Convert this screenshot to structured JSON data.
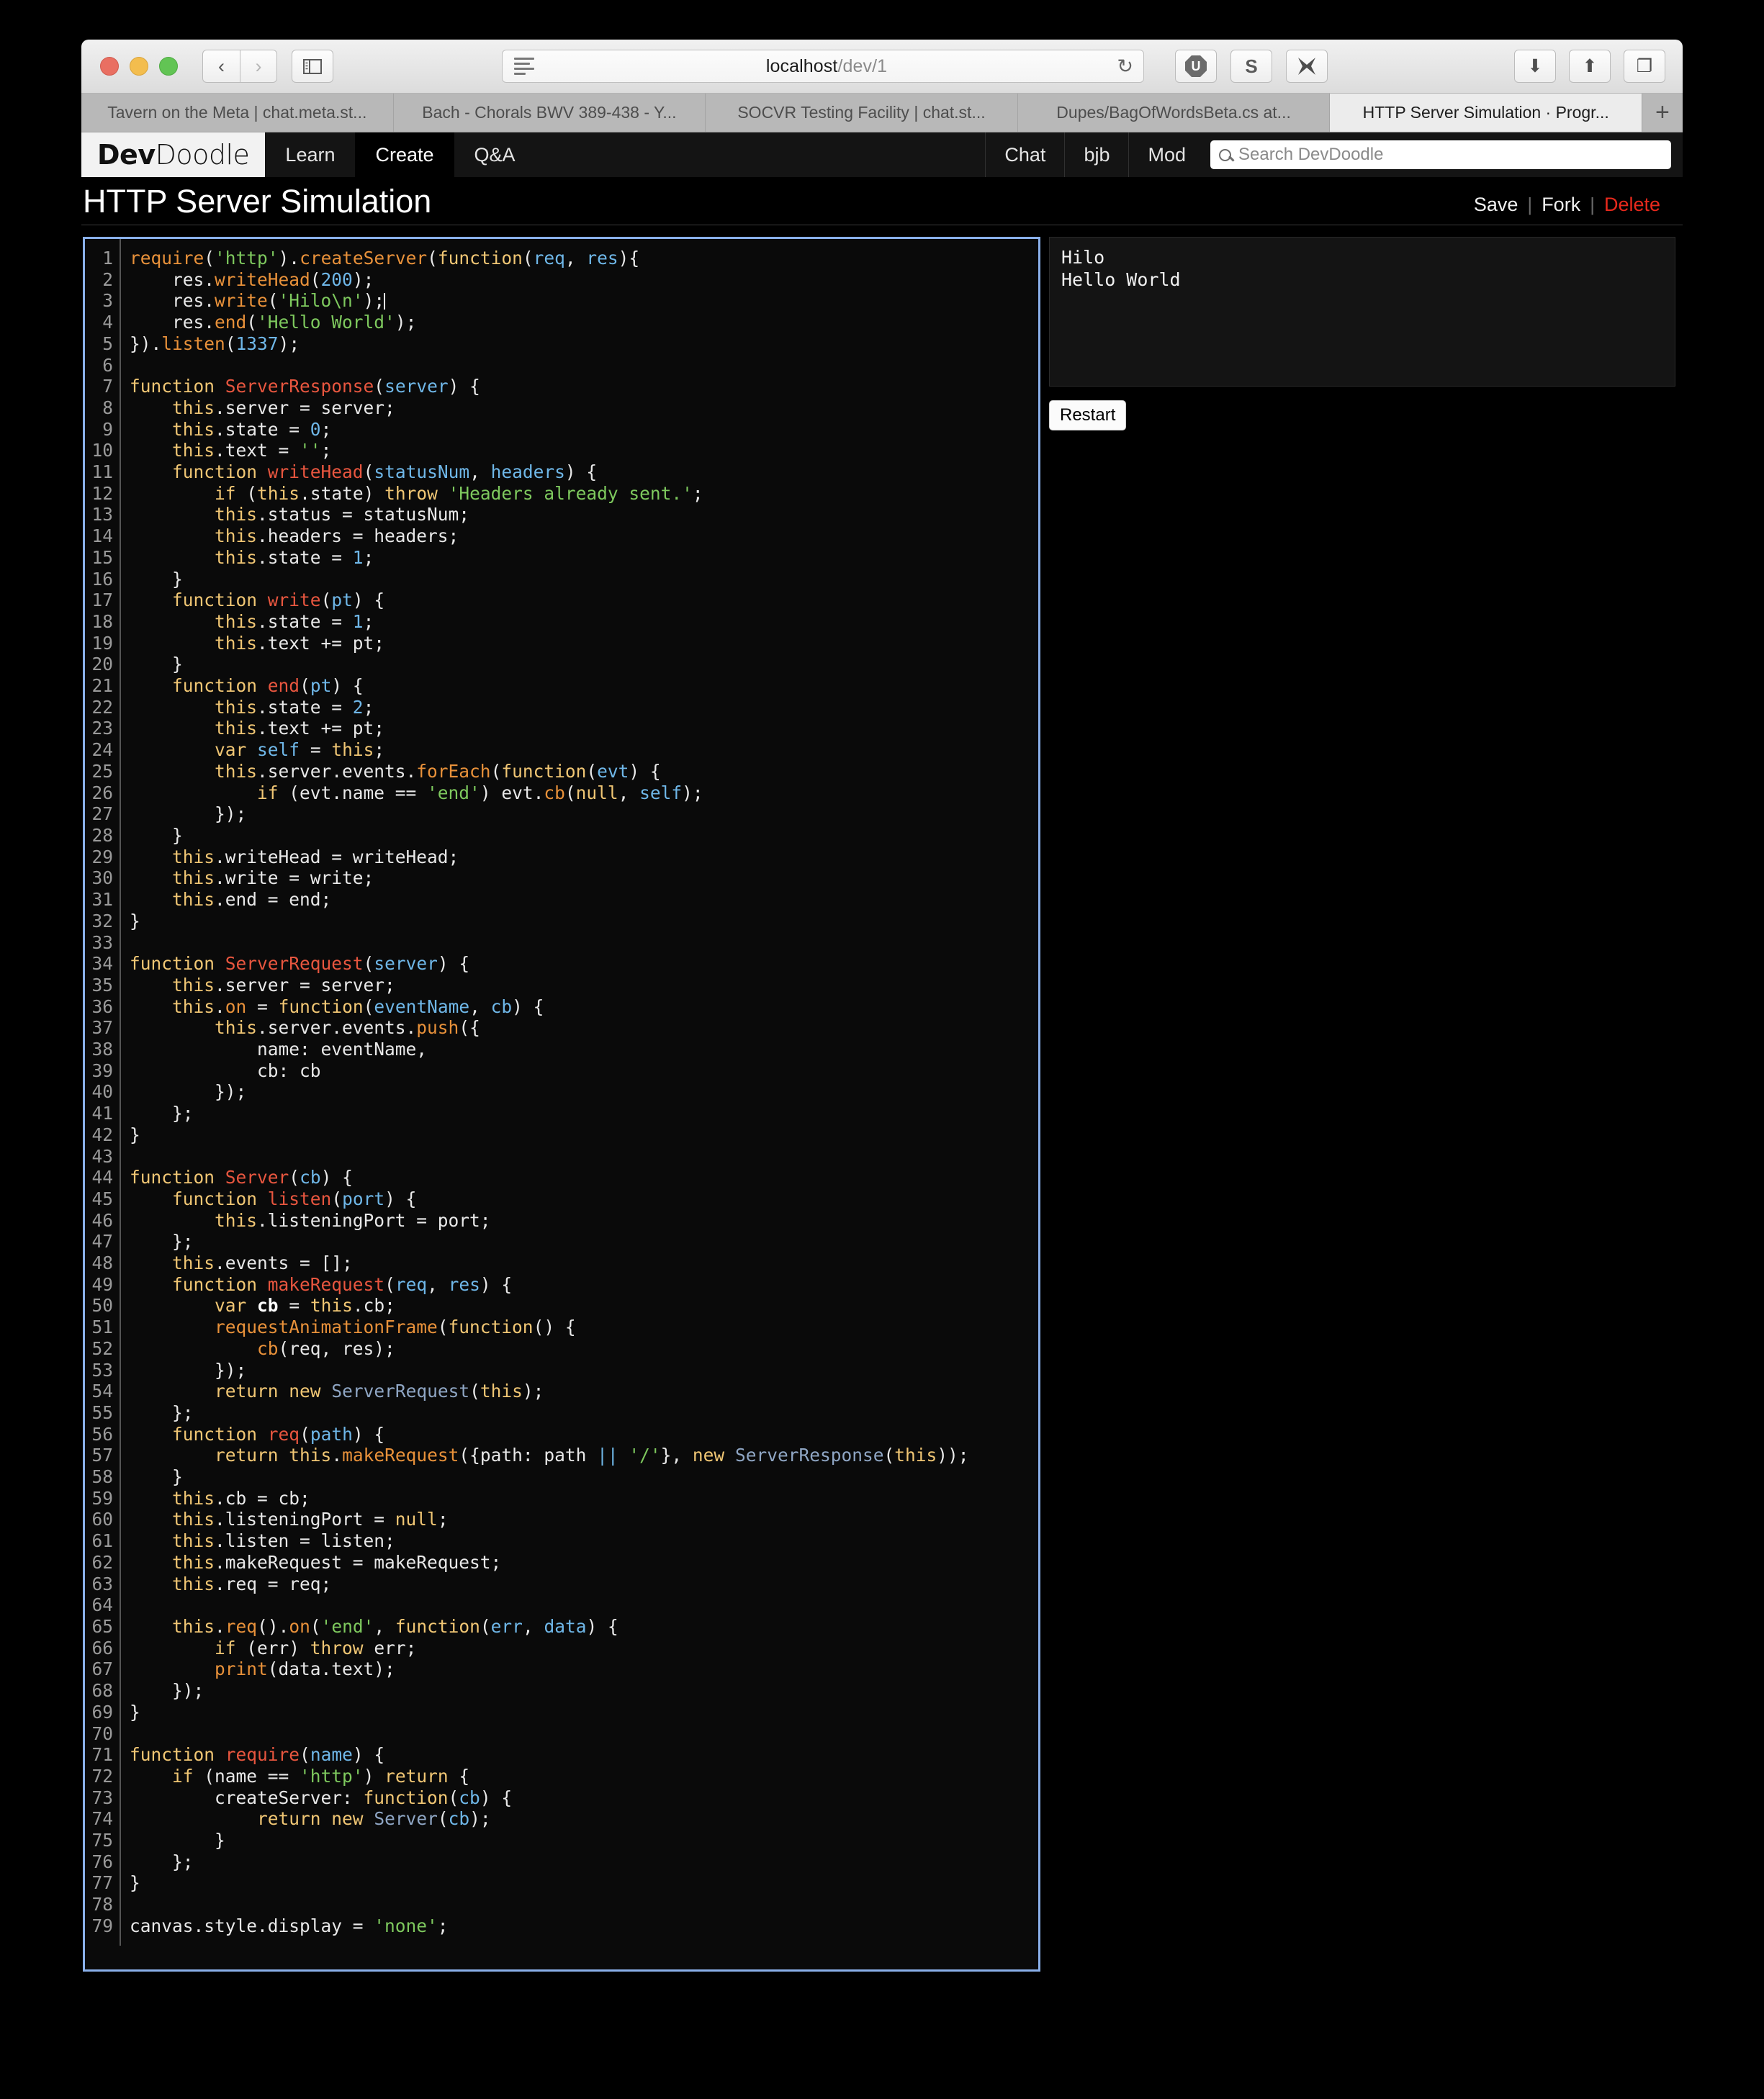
{
  "browser": {
    "url_host": "localhost",
    "url_path": "/dev/1",
    "reload_icon": "↻",
    "back_icon": "‹",
    "forward_icon": "›",
    "sidebar_icon": "▯",
    "download_icon": "⬇",
    "share_icon": "⬆",
    "tabs_icon": "❐",
    "newtab_icon": "+",
    "extensions": [
      {
        "name": "ublock-origin-icon",
        "label": "U"
      },
      {
        "name": "s-extension-icon",
        "label": "S"
      },
      {
        "name": "x-extension-icon",
        "label": "✖"
      }
    ],
    "tabs": [
      {
        "title": "Tavern on the Meta | chat.meta.st...",
        "active": false
      },
      {
        "title": "Bach - Chorals BWV 389-438 - Y...",
        "active": false
      },
      {
        "title": "SOCVR Testing Facility | chat.st...",
        "active": false
      },
      {
        "title": "Dupes/BagOfWordsBeta.cs at...",
        "active": false
      },
      {
        "title": "HTTP Server Simulation · Progr...",
        "active": true
      }
    ]
  },
  "site": {
    "logo_bold": "Dev",
    "logo_light": "Doodle",
    "nav_left": [
      {
        "label": "Learn",
        "selected": false
      },
      {
        "label": "Create",
        "selected": true
      },
      {
        "label": "Q&A",
        "selected": false
      }
    ],
    "nav_right": [
      {
        "label": "Chat"
      },
      {
        "label": "bjb"
      },
      {
        "label": "Mod"
      }
    ],
    "search_placeholder": "Search DevDoodle"
  },
  "page": {
    "title": "HTTP Server Simulation",
    "actions": {
      "save": "Save",
      "fork": "Fork",
      "delete": "Delete",
      "separator": "|"
    },
    "accent_border": "#8ab0ea",
    "delete_color": "#e8291c"
  },
  "output": {
    "console_text": "Hilo\nHello World",
    "restart_label": "Restart"
  },
  "editor": {
    "total_lines": 79,
    "cursor_line": 3,
    "lines": [
      "require('http').createServer(function(req, res){",
      "    res.writeHead(200);",
      "    res.write('Hilo\\n');",
      "    res.end('Hello World');",
      "}).listen(1337);",
      "",
      "function ServerResponse(server) {",
      "    this.server = server;",
      "    this.state = 0;",
      "    this.text = '';",
      "    function writeHead(statusNum, headers) {",
      "        if (this.state) throw 'Headers already sent.';",
      "        this.status = statusNum;",
      "        this.headers = headers;",
      "        this.state = 1;",
      "    }",
      "    function write(pt) {",
      "        this.state = 1;",
      "        this.text += pt;",
      "    }",
      "    function end(pt) {",
      "        this.state = 2;",
      "        this.text += pt;",
      "        var self = this;",
      "        this.server.events.forEach(function(evt) {",
      "            if (evt.name == 'end') evt.cb(null, self);",
      "        });",
      "    }",
      "    this.writeHead = writeHead;",
      "    this.write = write;",
      "    this.end = end;",
      "}",
      "",
      "function ServerRequest(server) {",
      "    this.server = server;",
      "    this.on = function(eventName, cb) {",
      "        this.server.events.push({",
      "            name: eventName,",
      "            cb: cb",
      "        });",
      "    };",
      "}",
      "",
      "function Server(cb) {",
      "    function listen(port) {",
      "        this.listeningPort = port;",
      "    };",
      "    this.events = [];",
      "    function makeRequest(req, res) {",
      "        var cb = this.cb;",
      "        requestAnimationFrame(function() {",
      "            cb(req, res);",
      "        });",
      "        return new ServerRequest(this);",
      "    };",
      "    function req(path) {",
      "        return this.makeRequest({path: path || '/'}, new ServerResponse(this));",
      "    }",
      "    this.cb = cb;",
      "    this.listeningPort = null;",
      "    this.listen = listen;",
      "    this.makeRequest = makeRequest;",
      "    this.req = req;",
      "",
      "    this.req().on('end', function(err, data) {",
      "        if (err) throw err;",
      "        print(data.text);",
      "    });",
      "}",
      "",
      "function require(name) {",
      "    if (name == 'http') return {",
      "        createServer: function(cb) {",
      "            return new Server(cb);",
      "        }",
      "    };",
      "}",
      "",
      "canvas.style.display = 'none';"
    ],
    "highlighted_html": [
      "<span class=\"mth\">require</span>(<span class=\"str\">'http'</span>).<span class=\"mth\">createServer</span>(<span class=\"kw\">function</span>(<span class=\"par\">req</span>, <span class=\"par\">res</span>){",
      "    res.<span class=\"mth\">writeHead</span>(<span class=\"num\">200</span>);",
      "    res.<span class=\"mth\">write</span>(<span class=\"str\">'Hilo\\n'</span>);<span class=\"caret\"></span>",
      "    res.<span class=\"mth\">end</span>(<span class=\"str\">'Hello World'</span>);",
      "}).<span class=\"mth\">listen</span>(<span class=\"num\">1337</span>);",
      "",
      "<span class=\"kw\">function</span> <span class=\"fn\">ServerResponse</span>(<span class=\"par\">server</span>) {",
      "    <span class=\"ths\">this</span>.server = server;",
      "    <span class=\"ths\">this</span>.state = <span class=\"num\">0</span>;",
      "    <span class=\"ths\">this</span>.text = <span class=\"str\">''</span>;",
      "    <span class=\"kw\">function</span> <span class=\"fn\">writeHead</span>(<span class=\"par\">statusNum</span>, <span class=\"par\">headers</span>) {",
      "        <span class=\"kw\">if</span> (<span class=\"ths\">this</span>.state) <span class=\"kw\">throw</span> <span class=\"str\">'Headers already sent.'</span>;",
      "        <span class=\"ths\">this</span>.status = statusNum;",
      "        <span class=\"ths\">this</span>.headers = headers;",
      "        <span class=\"ths\">this</span>.state = <span class=\"num\">1</span>;",
      "    }",
      "    <span class=\"kw\">function</span> <span class=\"fn\">write</span>(<span class=\"par\">pt</span>) {",
      "        <span class=\"ths\">this</span>.state = <span class=\"num\">1</span>;",
      "        <span class=\"ths\">this</span>.text += pt;",
      "    }",
      "    <span class=\"kw\">function</span> <span class=\"fn\">end</span>(<span class=\"par\">pt</span>) {",
      "        <span class=\"ths\">this</span>.state = <span class=\"num\">2</span>;",
      "        <span class=\"ths\">this</span>.text += pt;",
      "        <span class=\"kw\">var</span> <span class=\"par\">self</span> = <span class=\"ths\">this</span>;",
      "        <span class=\"ths\">this</span>.server.events.<span class=\"mth\">forEach</span>(<span class=\"kw\">function</span>(<span class=\"par\">evt</span>) {",
      "            <span class=\"kw\">if</span> (evt.name == <span class=\"str\">'end'</span>) evt.<span class=\"mth\">cb</span>(<span class=\"kw\">null</span>, <span class=\"par\">self</span>);",
      "        });",
      "    }",
      "    <span class=\"ths\">this</span>.writeHead = writeHead;",
      "    <span class=\"ths\">this</span>.write = write;",
      "    <span class=\"ths\">this</span>.end = end;",
      "}",
      "",
      "<span class=\"kw\">function</span> <span class=\"fn\">ServerRequest</span>(<span class=\"par\">server</span>) {",
      "    <span class=\"ths\">this</span>.server = server;",
      "    <span class=\"ths\">this</span>.<span class=\"mth\">on</span> = <span class=\"kw\">function</span>(<span class=\"par\">eventName</span>, <span class=\"par\">cb</span>) {",
      "        <span class=\"ths\">this</span>.server.events.<span class=\"mth\">push</span>({",
      "            name: eventName,",
      "            cb: cb",
      "        });",
      "    };",
      "}",
      "",
      "<span class=\"kw\">function</span> <span class=\"fn\">Server</span>(<span class=\"par\">cb</span>) {",
      "    <span class=\"kw\">function</span> <span class=\"fn\">listen</span>(<span class=\"par\">port</span>) {",
      "        <span class=\"ths\">this</span>.listeningPort = port;",
      "    };",
      "    <span class=\"ths\">this</span>.events = [];",
      "    <span class=\"kw\">function</span> <span class=\"fn\">makeRequest</span>(<span class=\"par\">req</span>, <span class=\"par\">res</span>) {",
      "        <span class=\"kw\">var</span> <span class=\"bold\">cb</span> = <span class=\"ths\">this</span>.cb;",
      "        <span class=\"mth\">requestAnimationFrame</span>(<span class=\"kw\">function</span>() {",
      "            <span class=\"mth\">cb</span>(req, res);",
      "        });",
      "        <span class=\"kw\">return</span> <span class=\"kw\">new</span> <span class=\"cls\">ServerRequest</span>(<span class=\"ths\">this</span>);",
      "    };",
      "    <span class=\"kw\">function</span> <span class=\"fn\">req</span>(<span class=\"par\">path</span>) {",
      "        <span class=\"kw\">return</span> <span class=\"ths\">this</span>.<span class=\"mth\">makeRequest</span>({path: path <span class=\"op\">||</span> <span class=\"str\">'/'</span>}, <span class=\"kw\">new</span> <span class=\"cls\">ServerResponse</span>(<span class=\"ths\">this</span>));",
      "    }",
      "    <span class=\"ths\">this</span>.cb = cb;",
      "    <span class=\"ths\">this</span>.listeningPort = <span class=\"kw\">null</span>;",
      "    <span class=\"ths\">this</span>.listen = listen;",
      "    <span class=\"ths\">this</span>.makeRequest = makeRequest;",
      "    <span class=\"ths\">this</span>.req = req;",
      "",
      "    <span class=\"ths\">this</span>.<span class=\"mth\">req</span>().<span class=\"mth\">on</span>(<span class=\"str\">'end'</span>, <span class=\"kw\">function</span>(<span class=\"par\">err</span>, <span class=\"par\">data</span>) {",
      "        <span class=\"kw\">if</span> (err) <span class=\"kw\">throw</span> err;",
      "        <span class=\"mth\">print</span>(data.text);",
      "    });",
      "}",
      "",
      "<span class=\"kw\">function</span> <span class=\"fn\">require</span>(<span class=\"par\">name</span>) {",
      "    <span class=\"kw\">if</span> (name == <span class=\"str\">'http'</span>) <span class=\"kw\">return</span> {",
      "        createServer: <span class=\"kw\">function</span>(<span class=\"par\">cb</span>) {",
      "            <span class=\"kw\">return</span> <span class=\"kw\">new</span> <span class=\"cls\">Server</span>(<span class=\"par\">cb</span>);",
      "        }",
      "    };",
      "}",
      "",
      "canvas.style.display = <span class=\"str\">'none'</span>;"
    ]
  }
}
